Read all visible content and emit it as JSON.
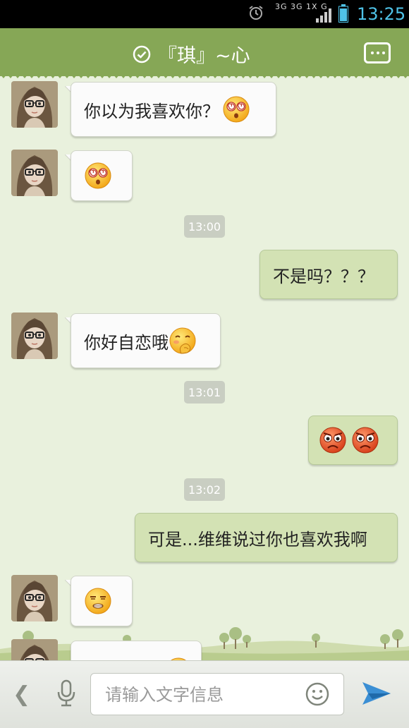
{
  "status_bar": {
    "network_text": "3G 3G 1X G",
    "time": "13:25",
    "icons": [
      "alarm-icon",
      "network-icon",
      "signal-icon",
      "battery-icon"
    ],
    "time_color": "#4fc3e8"
  },
  "header": {
    "title": "『琪』~心",
    "left_icon": "check-circle-icon",
    "right_icon": "more-menu-icon",
    "background": "#86a756"
  },
  "messages": [
    {
      "side": "in",
      "text": "你以为我喜欢你？",
      "emoji": [
        "dizzy"
      ]
    },
    {
      "side": "in",
      "text": "",
      "emoji": [
        "dizzy"
      ]
    },
    {
      "type": "timestamp",
      "text": "13:00"
    },
    {
      "side": "out",
      "text": "不是吗？？？",
      "emoji": []
    },
    {
      "side": "in",
      "text": "你好自恋哦",
      "emoji": [
        "shy"
      ]
    },
    {
      "type": "timestamp",
      "text": "13:01"
    },
    {
      "side": "out",
      "text": "",
      "emoji": [
        "angry",
        "angry"
      ]
    },
    {
      "type": "timestamp",
      "text": "13:02"
    },
    {
      "side": "out",
      "text": "可是...维维说过你也喜欢我啊",
      "emoji": []
    },
    {
      "side": "in",
      "text": "",
      "emoji": [
        "embarrassed"
      ]
    },
    {
      "side": "in",
      "text": "",
      "emoji": [
        "partial"
      ]
    }
  ],
  "input_bar": {
    "placeholder": "请输入文字信息",
    "value": "",
    "icons": [
      "back-chevron-icon",
      "microphone-icon",
      "smiley-icon",
      "send-icon"
    ]
  },
  "colors": {
    "chat_bg": "#e9f1dd",
    "incoming_bubble": "#fbfbfb",
    "outgoing_bubble": "#d3e2b4"
  }
}
